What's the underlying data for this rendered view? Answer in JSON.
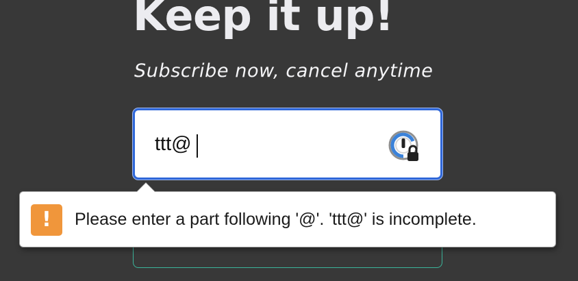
{
  "hero": {
    "title": "Keep it up!",
    "subtitle": "Subscribe now, cancel anytime"
  },
  "email_input": {
    "value": "ttt@",
    "icon": "password-manager-lock-icon"
  },
  "validation_tooltip": {
    "icon": "warning-icon",
    "icon_glyph": "!",
    "message": "Please enter a part following '@'. 'ttt@' is incomplete."
  },
  "colors": {
    "page_background": "#383838",
    "focus_border": "#2f67d8",
    "warning": "#f0963b",
    "accent_teal": "#3bb59b"
  }
}
